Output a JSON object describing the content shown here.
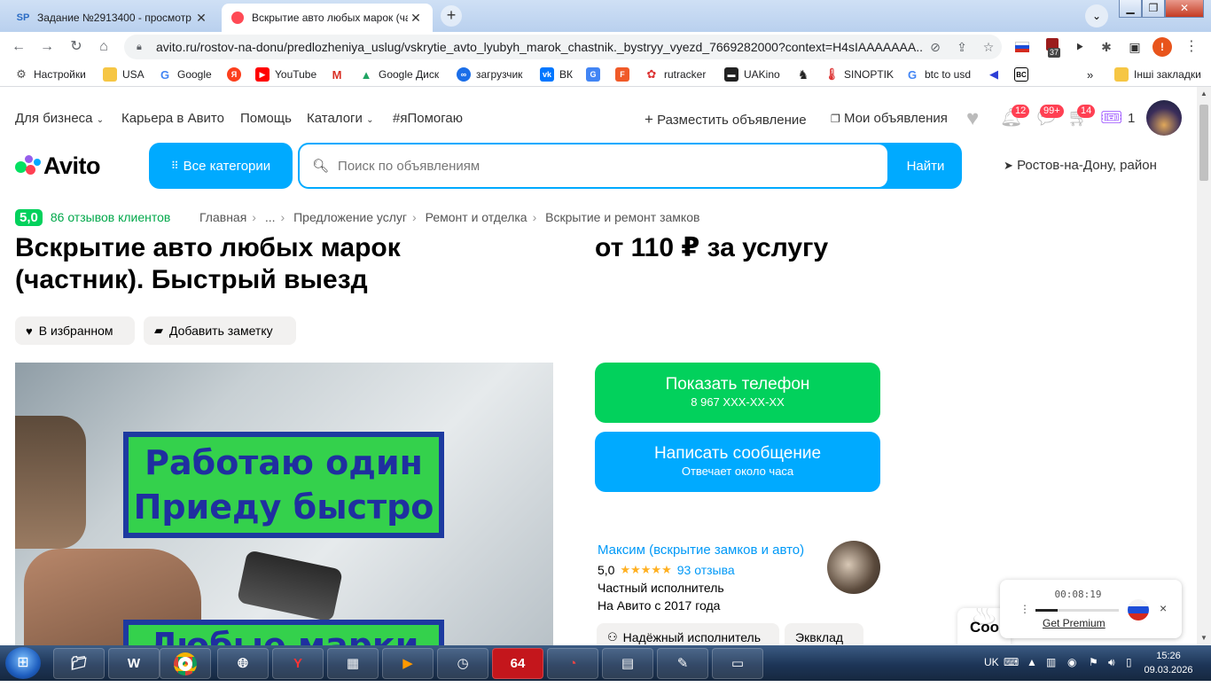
{
  "browser": {
    "tabs": [
      {
        "favicon": "SP",
        "title": "Задание №2913400 - просмотр",
        "active": false
      },
      {
        "favicon": "avito-icon",
        "title": "Вскрытие авто любых марок (ча",
        "active": true
      }
    ],
    "new_tab": "+",
    "url": "avito.ru/rostov-na-donu/predlozheniya_uslug/vskrytie_avto_lyubyh_marok_chastnik._bystryy_vyezd_7669282000?context=H4sIAAAAAAA...",
    "extension_badge": "37",
    "profile_letter": "!",
    "bookmarks": [
      {
        "label": "Настройки",
        "icon": "gear-icon"
      },
      {
        "label": "USA",
        "icon": "folder-icon"
      },
      {
        "label": "Google",
        "icon": "google-icon"
      },
      {
        "label": "",
        "icon": "yandex-icon"
      },
      {
        "label": "YouTube",
        "icon": "youtube-icon"
      },
      {
        "label": "",
        "icon": "gmail-icon"
      },
      {
        "label": "Google Диск",
        "icon": "drive-icon"
      },
      {
        "label": "загрузчик",
        "icon": "loader-icon"
      },
      {
        "label": "ВК",
        "icon": "vk-icon"
      },
      {
        "label": "",
        "icon": "translate-icon"
      },
      {
        "label": "",
        "icon": "f-icon"
      },
      {
        "label": "rutracker",
        "icon": "rutracker-icon"
      },
      {
        "label": "UAKino",
        "icon": "uakino-icon"
      },
      {
        "label": "",
        "icon": "chess-icon"
      },
      {
        "label": "SINOPTIK",
        "icon": "sinoptik-icon"
      },
      {
        "label": "btc to usd",
        "icon": "google-icon"
      },
      {
        "label": "",
        "icon": "arrow-icon"
      },
      {
        "label": "",
        "icon": "bc-icon"
      }
    ],
    "more_bookmarks": "»",
    "other_bookmarks": "Інші закладки"
  },
  "site": {
    "top_links": [
      "Для бизнеса",
      "Карьера в Авито",
      "Помощь",
      "Каталоги",
      "#яПомогаю"
    ],
    "post_ad": "Разместить объявление",
    "my_ads": "Мои объявления",
    "badges": {
      "notifications": "12",
      "messages": "99+",
      "cart": "14",
      "promo": "1"
    },
    "logo": "Avito",
    "all_categories": "Все категории",
    "search_placeholder": "Поиск по объявлениям",
    "search_button": "Найти",
    "location": "Ростов-на-Дону, район"
  },
  "listing": {
    "score": "5,0",
    "reviews_link": "86 отзывов клиентов",
    "breadcrumbs": [
      "Главная",
      "...",
      "Предложение услуг",
      "Ремонт и отделка",
      "Вскрытие и ремонт замков"
    ],
    "title": "Вскрытие авто любых марок (частник). Быстрый выезд",
    "price": "от 110 ₽ за услугу",
    "favorite_button": "В избранном",
    "note_button": "Добавить заметку",
    "photo_text": [
      "Работаю один",
      "Приеду быстро",
      "Любые марки"
    ],
    "show_phone": "Показать телефон",
    "phone_masked": "8 967 XXX-XX-XX",
    "write_message": "Написать сообщение",
    "reply_time": "Отвечает около часа",
    "seller": {
      "name": "Максим (вскрытие замков и авто)",
      "rating": "5,0",
      "stars": "★★★★★",
      "reviews": "93 отзыва",
      "type": "Частный исполнитель",
      "since": "На Авито с 2017 года"
    },
    "tags": [
      "Надёжный исполнитель",
      "Эквклад"
    ],
    "chat_partial": "Соо"
  },
  "player": {
    "time": "00:08:19",
    "progress": 0.27,
    "premium": "Get Premium",
    "close": "×"
  },
  "taskbar": {
    "app_badge": "64",
    "language": "UK",
    "time": "15:26",
    "date": "09.03.2026"
  }
}
